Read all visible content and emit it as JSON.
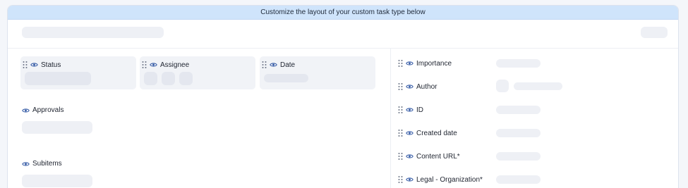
{
  "banner": {
    "text": "Customize the layout of your custom task type below"
  },
  "cards": [
    {
      "label": "Status"
    },
    {
      "label": "Assignee"
    },
    {
      "label": "Date"
    }
  ],
  "left_fields": [
    {
      "label": "Approvals"
    },
    {
      "label": "Subitems"
    }
  ],
  "right_fields": [
    {
      "label": "Importance"
    },
    {
      "label": "Author"
    },
    {
      "label": "ID"
    },
    {
      "label": "Created date"
    },
    {
      "label": "Content URL*"
    },
    {
      "label": "Legal - Organization*"
    }
  ],
  "colors": {
    "banner": "#cfe4fb",
    "icon": "#3a5fa8",
    "skeleton": "#eef0f5"
  }
}
